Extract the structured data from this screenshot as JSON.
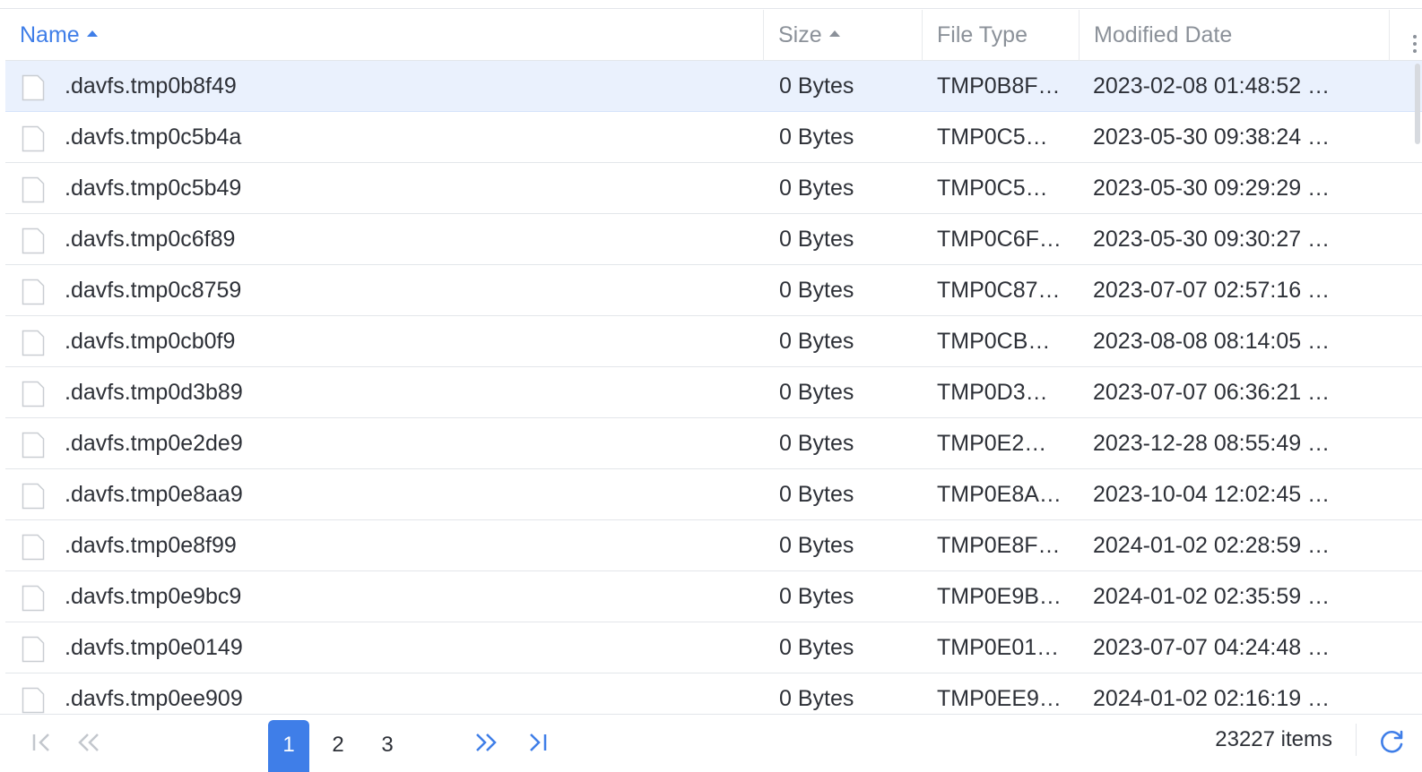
{
  "columns": [
    {
      "label": "Name",
      "sorted": true
    },
    {
      "label": "Size",
      "sorted": false
    },
    {
      "label": "File Type",
      "sorted": false
    },
    {
      "label": "Modified Date",
      "sorted": false
    }
  ],
  "rows": [
    {
      "name": ".davfs.tmp0b8f49",
      "size": "0 Bytes",
      "type": "TMP0B8F…",
      "modified": "2023-02-08 01:48:52 …",
      "selected": true
    },
    {
      "name": ".davfs.tmp0c5b4a",
      "size": "0 Bytes",
      "type": "TMP0C5…",
      "modified": "2023-05-30 09:38:24 …"
    },
    {
      "name": ".davfs.tmp0c5b49",
      "size": "0 Bytes",
      "type": "TMP0C5…",
      "modified": "2023-05-30 09:29:29 …"
    },
    {
      "name": ".davfs.tmp0c6f89",
      "size": "0 Bytes",
      "type": "TMP0C6F…",
      "modified": "2023-05-30 09:30:27 …"
    },
    {
      "name": ".davfs.tmp0c8759",
      "size": "0 Bytes",
      "type": "TMP0C87…",
      "modified": "2023-07-07 02:57:16 …"
    },
    {
      "name": ".davfs.tmp0cb0f9",
      "size": "0 Bytes",
      "type": "TMP0CB…",
      "modified": "2023-08-08 08:14:05 …"
    },
    {
      "name": ".davfs.tmp0d3b89",
      "size": "0 Bytes",
      "type": "TMP0D3…",
      "modified": "2023-07-07 06:36:21 …"
    },
    {
      "name": ".davfs.tmp0e2de9",
      "size": "0 Bytes",
      "type": "TMP0E2…",
      "modified": "2023-12-28 08:55:49 …"
    },
    {
      "name": ".davfs.tmp0e8aa9",
      "size": "0 Bytes",
      "type": "TMP0E8A…",
      "modified": "2023-10-04 12:02:45 …"
    },
    {
      "name": ".davfs.tmp0e8f99",
      "size": "0 Bytes",
      "type": "TMP0E8F…",
      "modified": "2024-01-02 02:28:59 …"
    },
    {
      "name": ".davfs.tmp0e9bc9",
      "size": "0 Bytes",
      "type": "TMP0E9B…",
      "modified": "2024-01-02 02:35:59 …"
    },
    {
      "name": ".davfs.tmp0e0149",
      "size": "0 Bytes",
      "type": "TMP0E01…",
      "modified": "2023-07-07 04:24:48 …"
    },
    {
      "name": ".davfs.tmp0ee909",
      "size": "0 Bytes",
      "type": "TMP0EE9…",
      "modified": "2024-01-02 02:16:19 …"
    }
  ],
  "pagination": {
    "pages": [
      "1",
      "2",
      "3"
    ],
    "current_page": "1",
    "items_count": "23227 items"
  },
  "colors": {
    "accent": "#3f7ee8",
    "selected_row": "#eaf1fd",
    "header_text": "#8b9199",
    "divider": "#e3e6ea"
  },
  "icons": {
    "file": "file-icon",
    "first_page": "first-page-icon",
    "prev_page": "prev-page-icon",
    "next_page": "next-page-icon",
    "last_page": "last-page-icon",
    "refresh": "refresh-icon",
    "column_menu": "more-vertical-icon"
  }
}
